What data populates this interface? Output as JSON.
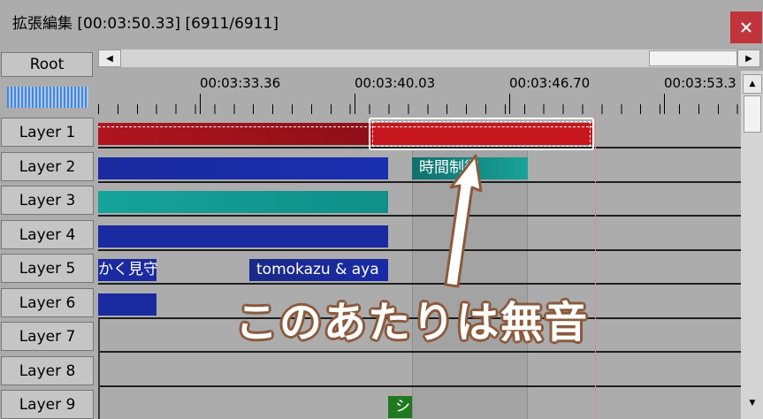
{
  "window": {
    "title": "拡張編集 [00:03:50.33] [6911/6911]",
    "close_label": "×"
  },
  "root_button": "Root",
  "ruler": {
    "labels": [
      "00:03:33.36",
      "00:03:40.03",
      "00:03:46.70",
      "00:03:53.3"
    ]
  },
  "layers": [
    {
      "label": "Layer 1"
    },
    {
      "label": "Layer 2"
    },
    {
      "label": "Layer 3"
    },
    {
      "label": "Layer 4"
    },
    {
      "label": "Layer 5"
    },
    {
      "label": "Layer 6"
    },
    {
      "label": "Layer 7"
    },
    {
      "label": "Layer 8"
    },
    {
      "label": "Layer 9"
    }
  ],
  "clips": {
    "layer2_label": "時間制御",
    "layer5_left_label": "かく見守",
    "layer5_right_label": "tomokazu & aya",
    "layer9_label": "シ"
  },
  "colors": {
    "audio_red": "#c01520",
    "audio_dark_red": "#a0101a",
    "video_blue": "#1a2aa0",
    "teal": "#14908a",
    "green": "#1f7a1f",
    "annotation_outline": "#8b5a3c"
  },
  "annotation": {
    "text": "このあたりは無音"
  }
}
